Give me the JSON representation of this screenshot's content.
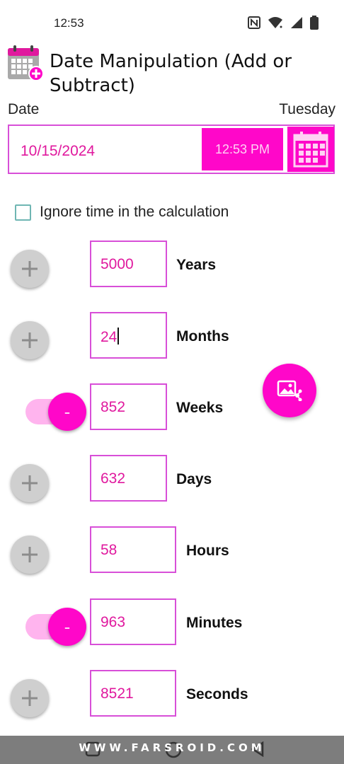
{
  "status_bar": {
    "time": "12:53",
    "icons": [
      "nfc-icon",
      "wifi-icon",
      "signal-icon",
      "battery-icon"
    ]
  },
  "app": {
    "title": "Date Manipulation (Add or Subtract)",
    "icon": "calendar-add-icon"
  },
  "date_section": {
    "label": "Date",
    "weekday": "Tuesday",
    "date_value": "10/15/2024",
    "time_button": "12:53 PM",
    "calendar_button_icon": "calendar-icon"
  },
  "ignore_time": {
    "label": "Ignore time in the calculation",
    "checked": false
  },
  "units": [
    {
      "label": "Years",
      "value": "5000",
      "mode": "add"
    },
    {
      "label": "Months",
      "value": "24",
      "mode": "add"
    },
    {
      "label": "Weeks",
      "value": "852",
      "mode": "subtract"
    },
    {
      "label": "Days",
      "value": "632",
      "mode": "add"
    },
    {
      "label": "Hours",
      "value": "58",
      "mode": "add"
    },
    {
      "label": "Minutes",
      "value": "963",
      "mode": "subtract"
    },
    {
      "label": "Seconds",
      "value": "8521",
      "mode": "add"
    }
  ],
  "toggle_symbol": "-",
  "fab_icon": "share-image-icon",
  "watermark": "WWW.FARSROID.COM",
  "colors": {
    "accent": "#ff07c9",
    "accent_text": "#e0199e",
    "border": "#d84fd8",
    "toggle_track": "#ffb4ee",
    "plus_button": "#cfcfcf"
  }
}
